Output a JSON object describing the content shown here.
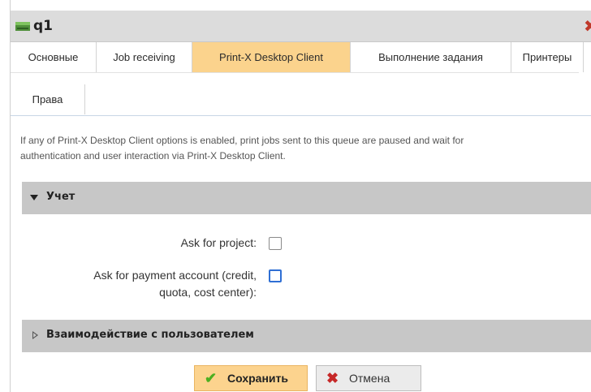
{
  "window": {
    "title": "q1"
  },
  "tabs": [
    {
      "label": "Основные",
      "active": false
    },
    {
      "label": "Job receiving",
      "active": false
    },
    {
      "label": "Print-X Desktop Client",
      "active": true
    },
    {
      "label": "Выполнение задания",
      "active": false
    },
    {
      "label": "Принтеры",
      "active": false
    },
    {
      "label": "Права",
      "active": false
    }
  ],
  "description": {
    "line1": "If any of Print-X Desktop Client options is enabled, print jobs sent to this queue are paused and wait for",
    "line2": "authentication and user interaction via Print-X Desktop Client."
  },
  "sections": {
    "accounting": {
      "title": "Учет",
      "expanded": true,
      "fields": {
        "ask_project": {
          "label": "Ask for project:",
          "checked": false
        },
        "ask_payment": {
          "label_line1": "Ask for payment account (credit,",
          "label_line2": "quota, cost center):",
          "checked": false
        }
      }
    },
    "interaction": {
      "title": "Взаимодействие с пользователем",
      "expanded": false
    }
  },
  "buttons": {
    "save": {
      "label": "Сохранить"
    },
    "cancel": {
      "label": "Отмена"
    }
  },
  "colors": {
    "active_tab": "#fbd38d",
    "section_bar": "#c7c7c7",
    "save_button": "#fcd38e",
    "focus_border": "#2f6fd4"
  }
}
